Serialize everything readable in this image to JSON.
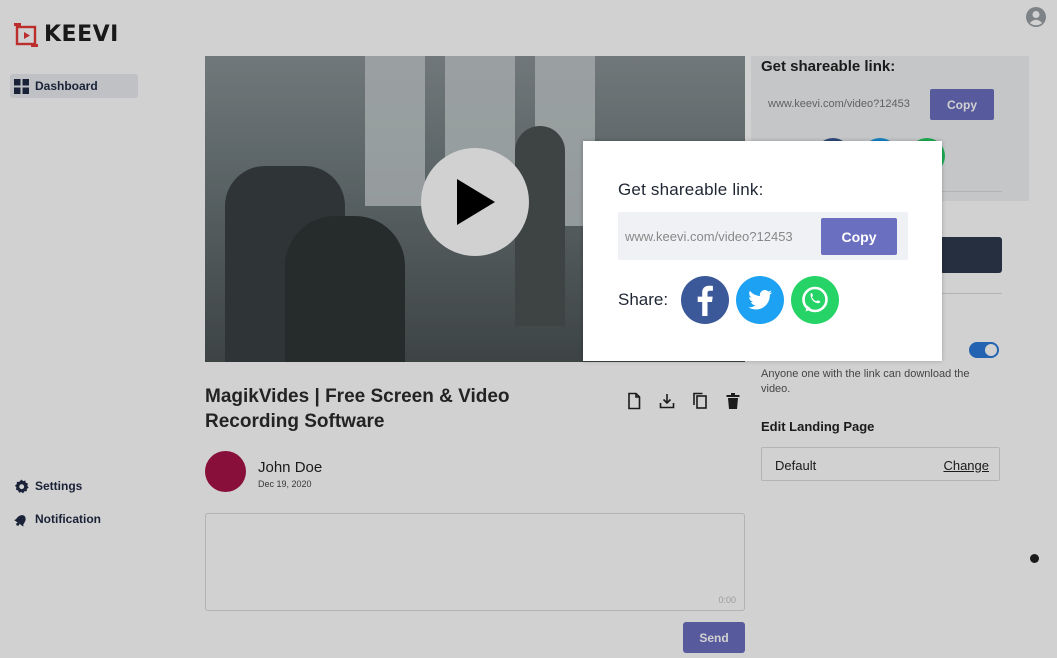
{
  "brand": {
    "name": "KEEVI",
    "accent": "#e53935"
  },
  "sidebar": {
    "items": [
      {
        "label": "Dashboard",
        "icon": "grid-icon"
      },
      {
        "label": "Settings",
        "icon": "gear-icon"
      },
      {
        "label": "Notification",
        "icon": "bell-icon"
      }
    ]
  },
  "video": {
    "title": "MagikVides | Free Screen & Video Recording Software",
    "author": {
      "name": "John Doe",
      "date": "Dec 19, 2020",
      "avatar_color": "#a51347"
    }
  },
  "actions": [
    {
      "icon": "document-icon"
    },
    {
      "icon": "download-icon"
    },
    {
      "icon": "copy-icon"
    },
    {
      "icon": "trash-icon"
    }
  ],
  "comment": {
    "timer": "0:00",
    "send_label": "Send"
  },
  "side_panel": {
    "share_title": "Get shareable link:",
    "link": "www.keevi.com/video?12453",
    "copy_label": "Copy",
    "download_note": "Anyone one with the link can download the video.",
    "landing_title": "Edit Landing Page",
    "landing_value": "Default",
    "landing_change": "Change"
  },
  "modal": {
    "title": "Get shareable link:",
    "link": "www.keevi.com/video?12453",
    "copy_label": "Copy",
    "share_label": "Share:",
    "networks": [
      {
        "name": "facebook",
        "color": "#3b5998"
      },
      {
        "name": "twitter",
        "color": "#1da1f2"
      },
      {
        "name": "whatsapp",
        "color": "#25d366"
      }
    ]
  },
  "colors": {
    "button": "#6b6fc0",
    "toggle": "#2b79d8"
  }
}
